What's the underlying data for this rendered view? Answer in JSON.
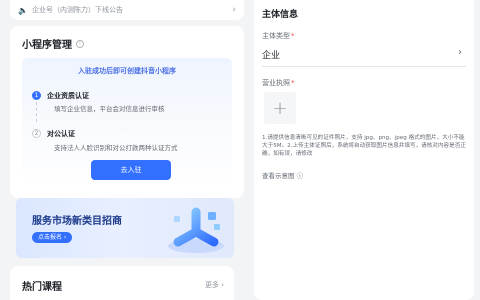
{
  "notice": {
    "text": "企业号（内测陈力）下线公告",
    "chevron": "›"
  },
  "mini_program": {
    "title": "小程序管理",
    "info_icon": "ⓘ",
    "headline": "入驻成功后即可创建抖音小程序",
    "steps": [
      {
        "num": "1",
        "title": "企业资质认证",
        "desc": "填写企业信息，平台会对信息进行审核"
      },
      {
        "num": "2",
        "title": "对公认证",
        "desc": "支持法人人脸识别和对公打款两种认证方式"
      }
    ],
    "button": "去入驻"
  },
  "banner": {
    "title": "服务市场新类目招商",
    "button": "点击报名 ›"
  },
  "courses": {
    "title": "热门课程",
    "more": "更多 ›"
  },
  "subject": {
    "title": "主体信息",
    "type_label": "主体类型",
    "type_value": "企业",
    "license_label": "营业执照",
    "required_mark": "*",
    "upload_plus": "+",
    "description": "1.请提供信息清晰可见的证件照片，支持 jpg、png、jpeg 格式的图片，大小不能大于5M。2.上传主体证照后，系统将自动获取图片信息并填写，请核对内容是否正确，如有误，请修改",
    "sample_link": "查看示意图 ⓘ"
  },
  "colors": {
    "primary": "#3370ff",
    "required": "#f54a45",
    "page_bg": "#f3f4f6"
  }
}
